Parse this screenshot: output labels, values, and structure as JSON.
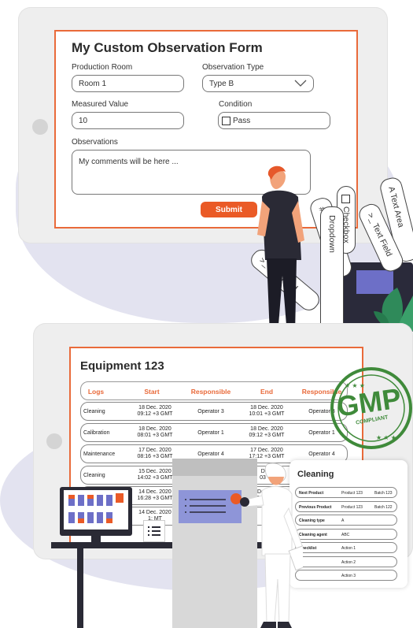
{
  "form": {
    "title": "My Custom Observation Form",
    "production_room_label": "Production Room",
    "production_room_value": "Room 1",
    "observation_type_label": "Observation Type",
    "observation_type_value": "Type B",
    "measured_value_label": "Measured Value",
    "measured_value_value": "10",
    "condition_label": "Condition",
    "condition_checkbox_label": "Pass",
    "observations_label": "Observations",
    "observations_value": "My comments will be here ...",
    "submit_label": "Submit"
  },
  "field_strips": [
    {
      "label": "# Number"
    },
    {
      "label": "A Text Area"
    },
    {
      "label": ">_ Text Field"
    },
    {
      "label": "Checkbox"
    },
    {
      "label": "Dropdown"
    },
    {
      "label": ">_ Text Field"
    }
  ],
  "equipment": {
    "title": "Equipment 123",
    "columns": [
      "Logs",
      "Start",
      "Responsible",
      "End",
      "Responsible"
    ],
    "rows": [
      {
        "log": "Cleaning",
        "start": "18 Dec. 2020",
        "start_time": "09:12 +3 GMT",
        "responsible": "Operator 3",
        "end": "18 Dec. 2020",
        "end_time": "10:01 +3 GMT",
        "responsible2": "Operator 3"
      },
      {
        "log": "Calibration",
        "start": "18 Dec. 2020",
        "start_time": "08:01 +3 GMT",
        "responsible": "Operator 1",
        "end": "18 Dec. 2020",
        "end_time": "09:12 +3 GMT",
        "responsible2": "Operator 1"
      },
      {
        "log": "Maintenance",
        "start": "17 Dec. 2020",
        "start_time": "08:16 +3 GMT",
        "responsible": "Operator 4",
        "end": "17 Dec. 2020",
        "end_time": "17:12 +3 GMT",
        "responsible2": "Operator 4"
      },
      {
        "log": "Cleaning",
        "start": "15 Dec. 2020",
        "start_time": "14:02 +3 GMT",
        "responsible": "",
        "end": "Dec.",
        "end_time": "03 +3",
        "responsible2": ""
      },
      {
        "log": "",
        "start": "14 Dec. 2020",
        "start_time": "16:28 +3 GMT",
        "responsible": "",
        "end": "Dec. 20",
        "end_time": "02 +3 G",
        "responsible2": ""
      },
      {
        "log": "",
        "start": "14 Dec. 2020",
        "start_time": "1: MT",
        "responsible": "",
        "end": "",
        "end_time": "",
        "responsible2": ""
      }
    ]
  },
  "gmp_badge": {
    "big": "GMP",
    "small": "COMPLIANT"
  },
  "cleaning": {
    "title": "Cleaning",
    "rows": [
      {
        "label": "Next Product",
        "v1": "Product 123",
        "v2": "Batch 123"
      },
      {
        "label": "Previous Product",
        "v1": "Product 123",
        "v2": "Batch 122"
      },
      {
        "label": "Cleaning type",
        "v1": "A",
        "v2": ""
      },
      {
        "label": "Cleaning agent",
        "v1": "ABC",
        "v2": ""
      },
      {
        "label": "Checklist",
        "v1": "Action 1",
        "v2": ""
      },
      {
        "label": "",
        "v1": "Action 2",
        "v2": ""
      },
      {
        "label": "",
        "v1": "Action 3",
        "v2": ""
      }
    ]
  },
  "colors": {
    "accent": "#ea5a26",
    "gmp_green": "#3f8a3a",
    "blob": "#e3e3f0",
    "shirt": "#2a2a35"
  }
}
